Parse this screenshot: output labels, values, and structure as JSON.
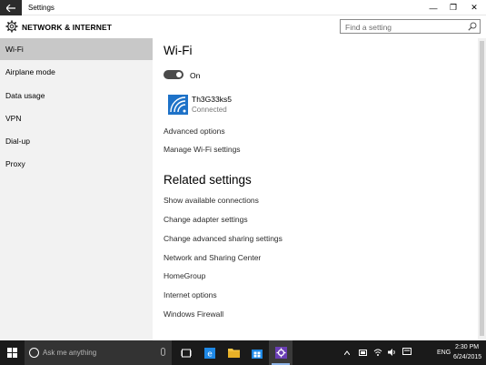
{
  "window": {
    "title": "Settings",
    "back_icon": "back-arrow-icon",
    "minimize_glyph": "—",
    "maximize_glyph": "❐",
    "close_glyph": "✕"
  },
  "header": {
    "title": "NETWORK & INTERNET",
    "search_placeholder": "Find a setting"
  },
  "sidebar": {
    "items": [
      {
        "label": "Wi-Fi",
        "active": true
      },
      {
        "label": "Airplane mode"
      },
      {
        "label": "Data usage"
      },
      {
        "label": "VPN"
      },
      {
        "label": "Dial-up"
      },
      {
        "label": "Proxy"
      }
    ]
  },
  "main": {
    "title": "Wi-Fi",
    "toggle_label": "On",
    "network": {
      "name": "Th3G33ks5",
      "status": "Connected"
    },
    "links": [
      "Advanced options",
      "Manage Wi-Fi settings"
    ],
    "related_title": "Related settings",
    "related_links": [
      "Show available connections",
      "Change adapter settings",
      "Change advanced sharing settings",
      "Network and Sharing Center",
      "HomeGroup",
      "Internet options",
      "Windows Firewall"
    ]
  },
  "taskbar": {
    "search_placeholder": "Ask me anything",
    "lang": "ENG",
    "time": "2:30 PM",
    "date": "6/24/2015"
  },
  "colors": {
    "accent": "#1e72c8",
    "sidebar_bg": "#f2f2f2",
    "active_item": "#c8c8c8",
    "taskbar": "#1a1a1a"
  }
}
